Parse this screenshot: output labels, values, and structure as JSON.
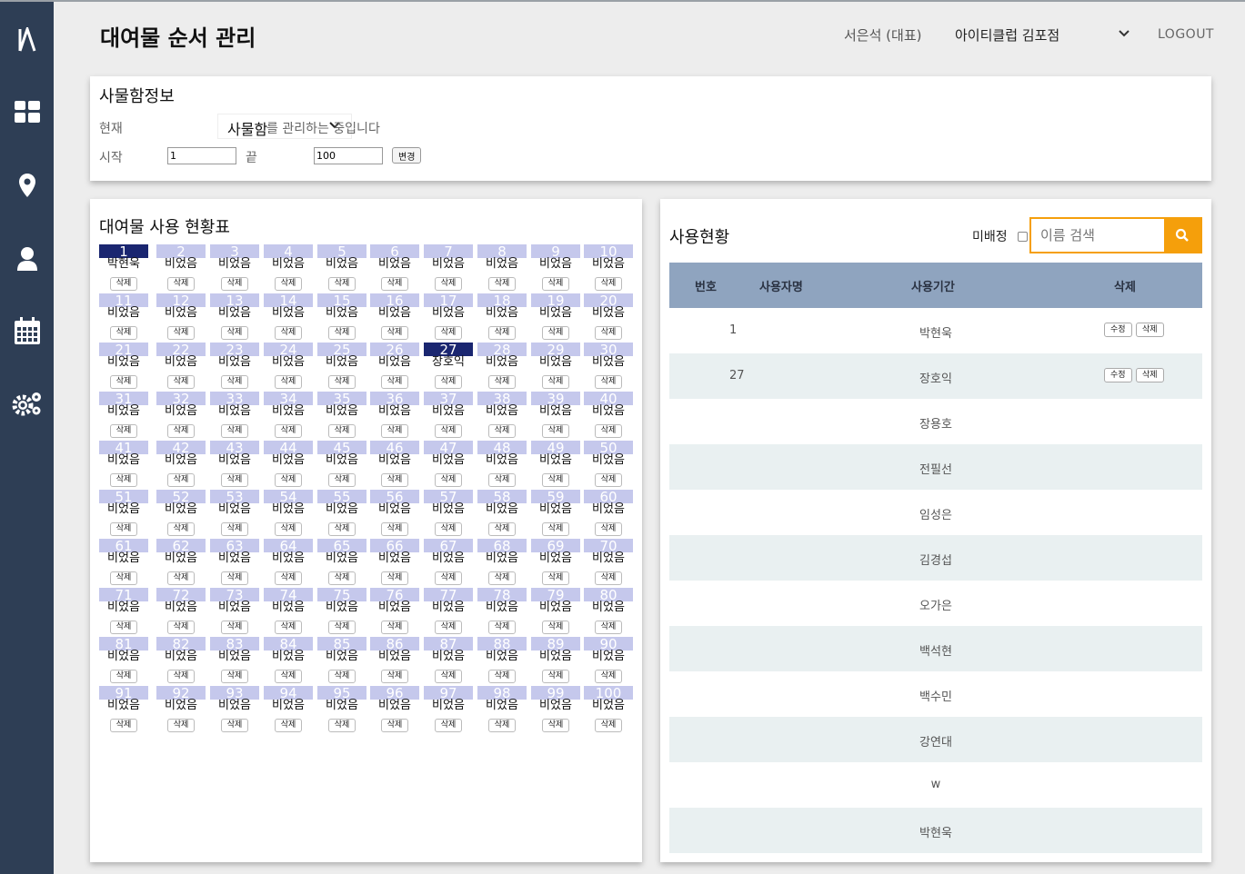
{
  "header": {
    "title": "대여물 순서 관리",
    "user": "서은석 (대표)",
    "store": "아이티클럽 김포점",
    "logout": "LOGOUT"
  },
  "sidebar": {
    "logo": "A",
    "icons": [
      "dashboard-icon",
      "location-pin-icon",
      "user-icon",
      "calendar-icon",
      "settings-gears-icon"
    ]
  },
  "locker_info": {
    "title": "사물함정보",
    "current_label": "현재",
    "current_value": "사물함",
    "managing_text": "를 관리하는 중입니다",
    "start_label": "시작",
    "start_value": "1",
    "end_label": "끝",
    "end_value": "100",
    "change_button": "변경"
  },
  "usage_grid": {
    "title": "대여물 사용 현황표",
    "empty_label": "비었음",
    "delete_label": "삭제",
    "occupied": {
      "1": "박현욱",
      "27": "장호익"
    },
    "count": 100
  },
  "usage_status": {
    "title": "사용현황",
    "unassigned_label": "미배정",
    "search_placeholder": "이름 검색",
    "columns": [
      "번호",
      "사용자명",
      "사용기간",
      "삭제"
    ],
    "edit_label": "수정",
    "delete_label": "삭제",
    "rows": [
      {
        "number": "1",
        "name": "박현욱",
        "has_actions": true
      },
      {
        "number": "27",
        "name": "장호익",
        "has_actions": true
      },
      {
        "number": "",
        "name": "장용호",
        "has_actions": false
      },
      {
        "number": "",
        "name": "전필선",
        "has_actions": false
      },
      {
        "number": "",
        "name": "임성은",
        "has_actions": false
      },
      {
        "number": "",
        "name": "김경섭",
        "has_actions": false
      },
      {
        "number": "",
        "name": "오가은",
        "has_actions": false
      },
      {
        "number": "",
        "name": "백석현",
        "has_actions": false
      },
      {
        "number": "",
        "name": "백수민",
        "has_actions": false
      },
      {
        "number": "",
        "name": "강연대",
        "has_actions": false
      },
      {
        "number": "",
        "name": "w",
        "has_actions": false
      },
      {
        "number": "",
        "name": "박현욱",
        "has_actions": false
      }
    ]
  },
  "colors": {
    "sidebar": "#2e3e55",
    "accent": "#f59f0b",
    "cell_header": "#c5c8ec",
    "cell_active": "#1a2670",
    "table_header": "#8fa4bf"
  }
}
